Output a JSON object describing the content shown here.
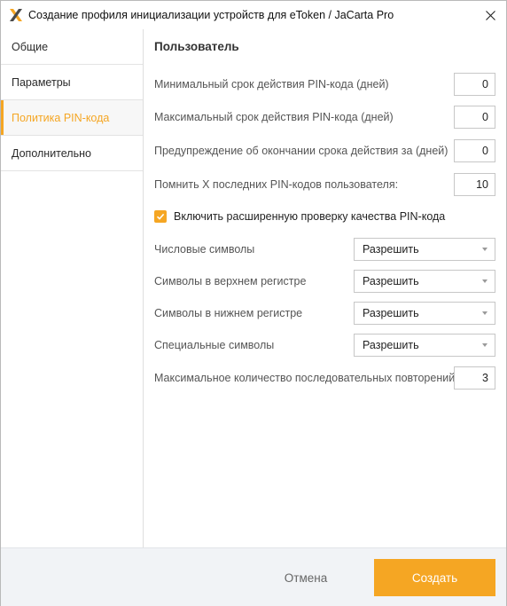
{
  "window": {
    "title": "Создание профиля инициализации устройств для eToken / JaCarta Pro"
  },
  "colors": {
    "accent": "#f5a623",
    "footer_bg": "#f1f3f6"
  },
  "sidebar": {
    "items": [
      {
        "label": "Общие",
        "active": false
      },
      {
        "label": "Параметры",
        "active": false
      },
      {
        "label": "Политика PIN-кода",
        "active": true
      },
      {
        "label": "Дополнительно",
        "active": false
      }
    ]
  },
  "main": {
    "section_title": "Пользователь",
    "numeric_fields": [
      {
        "label": "Минимальный срок действия PIN-кода (дней)",
        "value": "0"
      },
      {
        "label": "Максимальный срок действия PIN-кода (дней)",
        "value": "0"
      },
      {
        "label": "Предупреждение об окончании срока действия за (дней)",
        "value": "0"
      },
      {
        "label": "Помнить X последних PIN-кодов пользователя:",
        "value": "10"
      }
    ],
    "quality_check": {
      "label": "Включить расширенную проверку качества PIN-кода",
      "checked": true
    },
    "char_rules": [
      {
        "label": "Числовые символы",
        "value": "Разрешить"
      },
      {
        "label": "Символы в верхнем регистре",
        "value": "Разрешить"
      },
      {
        "label": "Символы в нижнем регистре",
        "value": "Разрешить"
      },
      {
        "label": "Специальные символы",
        "value": "Разрешить"
      }
    ],
    "max_repeats": {
      "label": "Максимальное количество последовательных повторений",
      "value": "3"
    }
  },
  "footer": {
    "cancel_label": "Отмена",
    "create_label": "Создать"
  },
  "icons": {
    "app": "jacarta-x-logo-icon",
    "close": "close-icon",
    "checkbox": "checkmark-icon",
    "dropdown": "dropdown-arrow-icon"
  }
}
